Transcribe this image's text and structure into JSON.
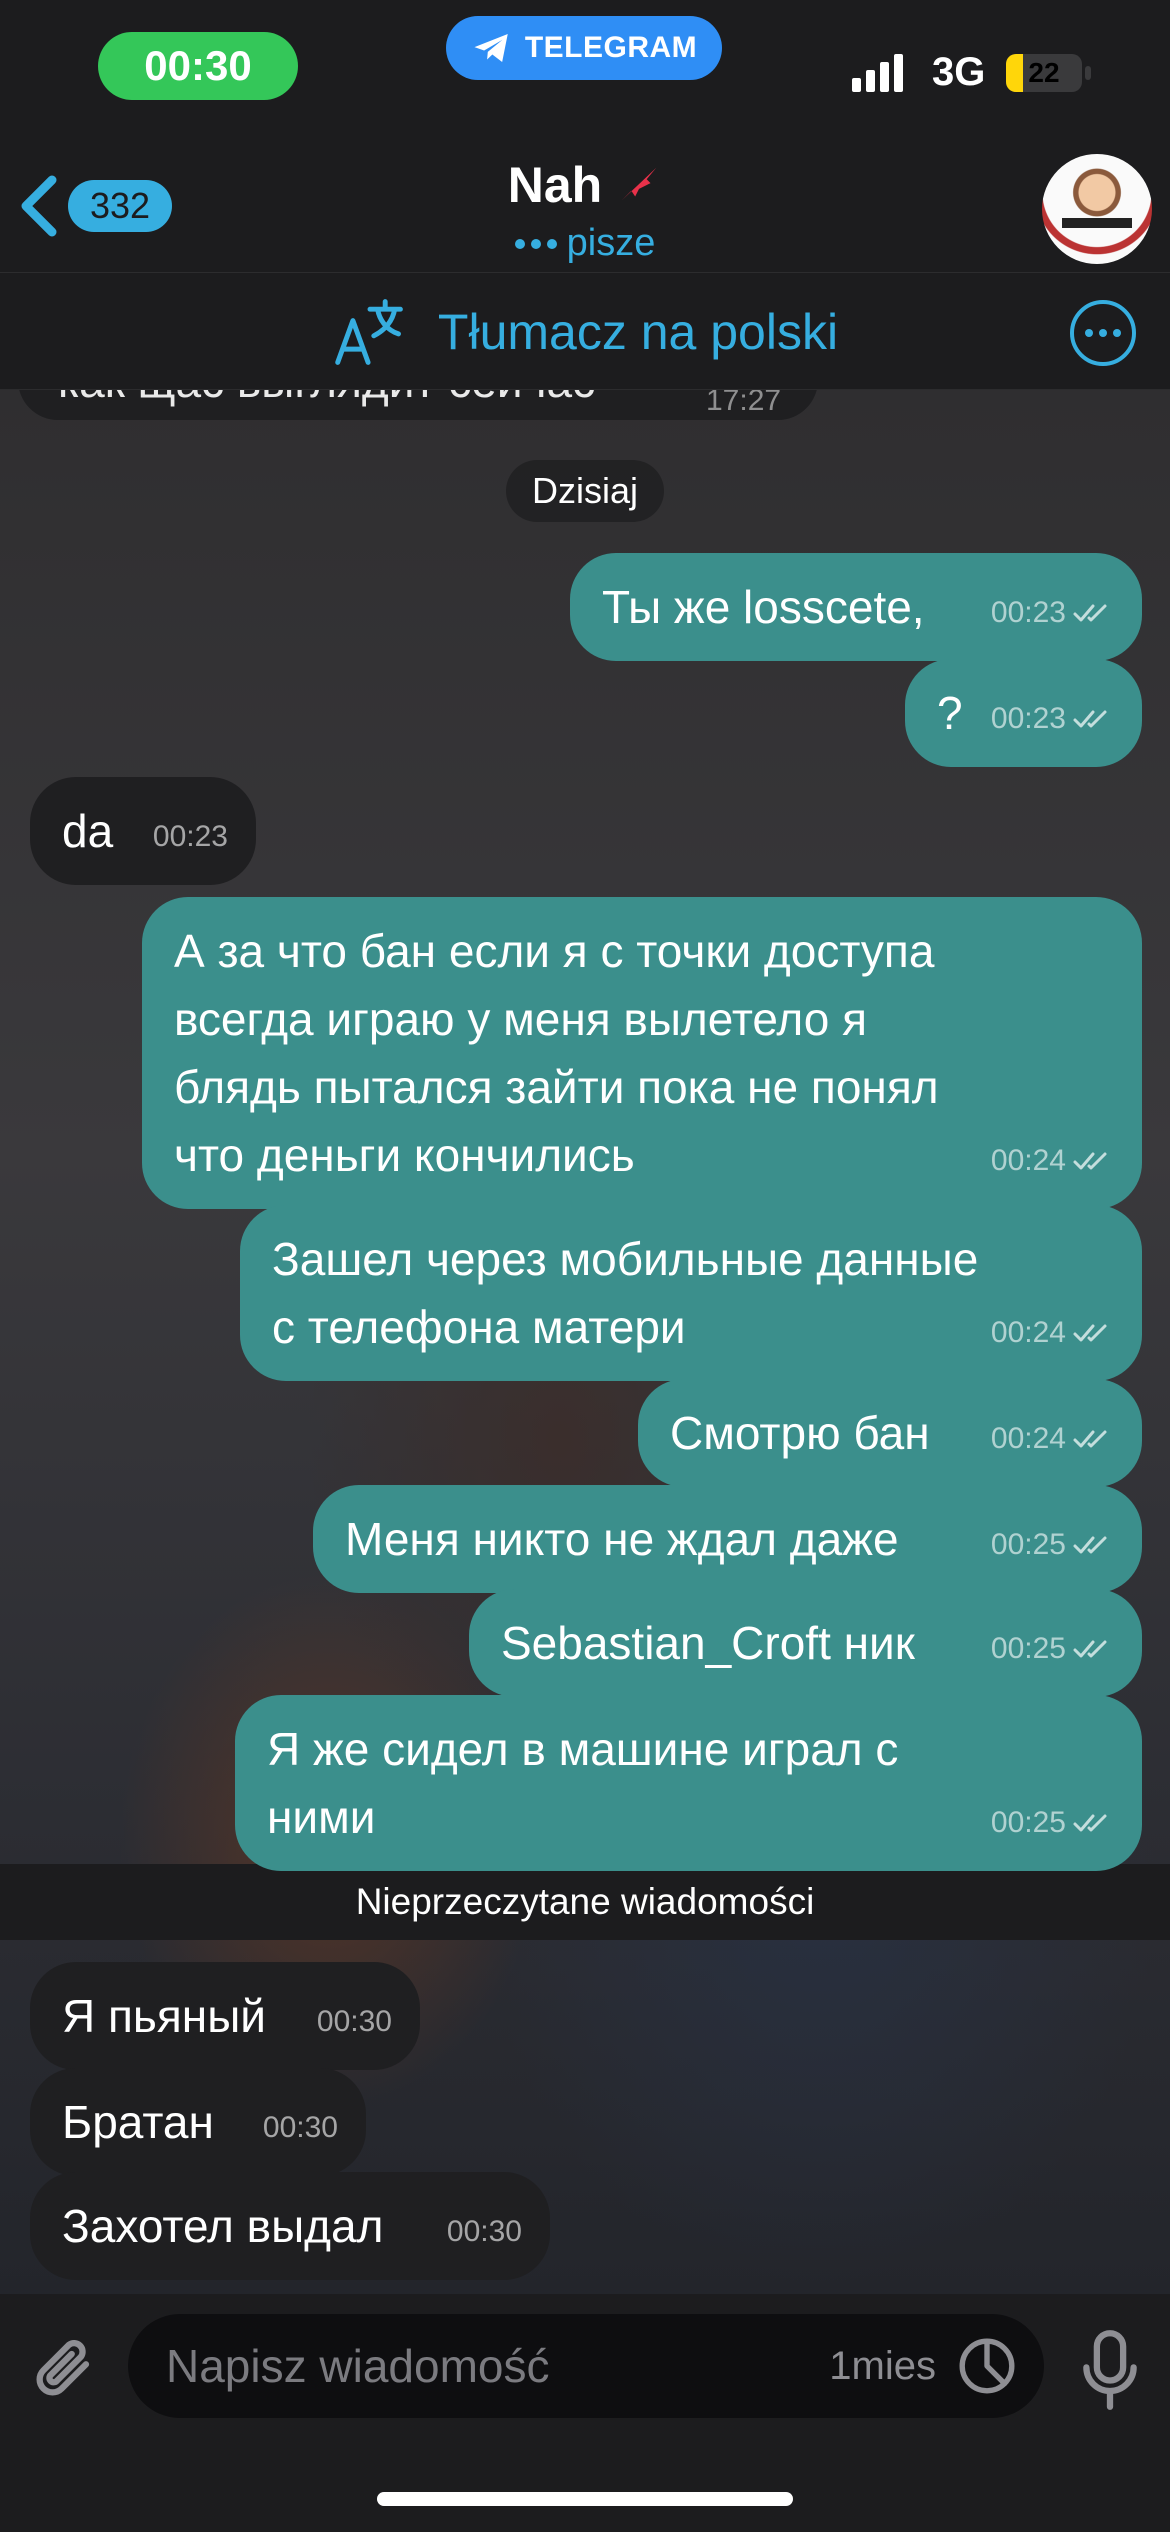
{
  "status_bar": {
    "time": "00:30",
    "app_pill_label": "TELEGRAM",
    "network": "3G",
    "battery": "22",
    "battery_level": 0.22
  },
  "header": {
    "back_count": "332",
    "chat_name": "Nah",
    "status": "pisze"
  },
  "translate_bar": {
    "label": "Tłumacz na polski"
  },
  "chat": {
    "partial_message": {
      "text": "как щас выглядит сейчас",
      "time": "17:27"
    },
    "date_separator": "Dzisiaj",
    "messages": [
      {
        "direction": "out",
        "text": "Ты же losscete,",
        "time": "00:23"
      },
      {
        "direction": "out",
        "text": "?",
        "time": "00:23"
      },
      {
        "direction": "in",
        "text": "da",
        "time": "00:23"
      },
      {
        "direction": "out",
        "text": "А за что бан если я с точки доступа всегда играю у меня вылетело я блядь пытался зайти пока не понял что деньги кончились",
        "time": "00:24"
      },
      {
        "direction": "out",
        "text": "Зашел через мобильные данные с телефона матери",
        "time": "00:24"
      },
      {
        "direction": "out",
        "text": "Смотрю бан",
        "time": "00:24"
      },
      {
        "direction": "out",
        "text": "Меня никто не ждал даже",
        "time": "00:25"
      },
      {
        "direction": "out",
        "text": "Sebastian_Croft ник",
        "time": "00:25"
      },
      {
        "direction": "out",
        "text": "Я же сидел в машине играл с ними",
        "time": "00:25"
      },
      {
        "direction": "in",
        "text": "Я пьяный",
        "time": "00:30"
      },
      {
        "direction": "in",
        "text": "Братан",
        "time": "00:30"
      },
      {
        "direction": "in",
        "text": "Захотел выдал",
        "time": "00:30"
      }
    ],
    "unread_divider": "Nieprzeczytane wiadomości"
  },
  "input": {
    "placeholder": "Napisz wiadomość",
    "timer_label": "1mies"
  },
  "colors": {
    "accent": "#36aee0",
    "outgoing_bubble": "#3b8f8c",
    "incoming_bubble": "#1f1f21",
    "time_pill": "#34c759",
    "telegram_pill": "#2f8ef5",
    "battery_fill": "#ffd60a"
  },
  "icons": {
    "back": "chevron-left-icon",
    "name_badge": "arrow-badge-icon",
    "translate": "translate-icon",
    "more": "more-icon",
    "attach": "paperclip-icon",
    "timer": "timer-icon",
    "mic": "microphone-icon",
    "read": "double-check-icon"
  }
}
